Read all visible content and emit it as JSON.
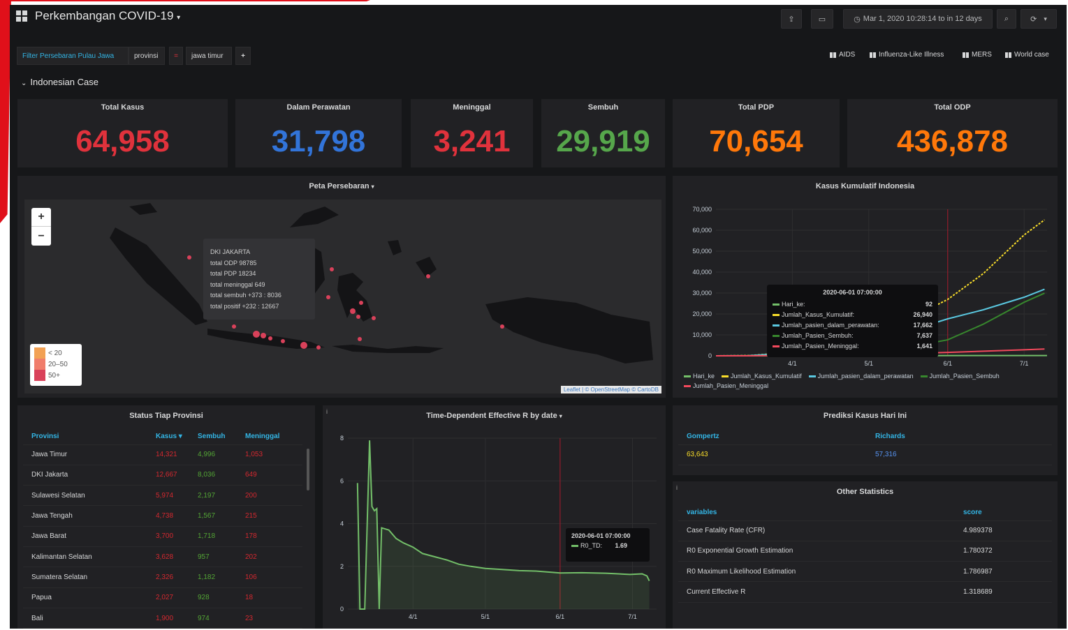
{
  "header": {
    "title": "Perkembangan COVID-19",
    "time_range": "Mar 1, 2020 10:28:14 to in 12 days"
  },
  "variables": {
    "filter_label": "Filter Persebaran Pulau Jawa",
    "var_name": "provinsi",
    "var_value": "jawa timur",
    "add_symbol": "+"
  },
  "links": [
    "AIDS",
    "Influenza-Like Illness",
    "MERS",
    "World case"
  ],
  "row_title": "Indonesian Case",
  "stats": [
    {
      "title": "Total Kasus",
      "value": "64,958",
      "color": "#e0323c"
    },
    {
      "title": "Dalam Perawatan",
      "value": "31,798",
      "color": "#3274d9"
    },
    {
      "title": "Meninggal",
      "value": "3,241",
      "color": "#e0323c"
    },
    {
      "title": "Sembuh",
      "value": "29,919",
      "color": "#56a64b"
    },
    {
      "title": "Total PDP",
      "value": "70,654",
      "color": "#ff780a"
    },
    {
      "title": "Total ODP",
      "value": "436,878",
      "color": "#ff780a"
    }
  ],
  "map_panel": {
    "title": "Peta Persebaran",
    "zoom_in": "+",
    "zoom_out": "−",
    "tooltip": [
      "DKI JAKARTA",
      "total ODP 98785",
      "total PDP 18234",
      "total meninggal 649",
      "total sembuh +373 : 8036",
      "total positif +232 : 12667"
    ],
    "legend": [
      {
        "label": "< 20",
        "color": "#f2a154"
      },
      {
        "label": "20–50",
        "color": "#f07d6b"
      },
      {
        "label": "50+",
        "color": "#d9415a"
      }
    ],
    "attribution": "Leaflet | © OpenStreetMap © CartoDB"
  },
  "cumulative_panel": {
    "title": "Kasus Kumulatif Indonesia",
    "tooltip_header": "2020-06-01 07:00:00",
    "tooltip_rows": [
      {
        "name": "Hari_ke:",
        "value": "92",
        "color": "#73bf69"
      },
      {
        "name": "Jumlah_Kasus_Kumulatif:",
        "value": "26,940",
        "color": "#fade2a"
      },
      {
        "name": "Jumlah_pasien_dalam_perawatan:",
        "value": "17,662",
        "color": "#5ac8e0"
      },
      {
        "name": "Jumlah_Pasien_Sembuh:",
        "value": "7,637",
        "color": "#37872d"
      },
      {
        "name": "Jumlah_Pasien_Meninggal:",
        "value": "1,641",
        "color": "#f2495c"
      }
    ],
    "legend": [
      {
        "name": "Hari_ke",
        "color": "#73bf69"
      },
      {
        "name": "Jumlah_Kasus_Kumulatif",
        "color": "#fade2a"
      },
      {
        "name": "Jumlah_pasien_dalam_perawatan",
        "color": "#5ac8e0"
      },
      {
        "name": "Jumlah_Pasien_Sembuh",
        "color": "#37872d"
      },
      {
        "name": "Jumlah_Pasien_Meninggal",
        "color": "#f2495c"
      }
    ]
  },
  "province_panel": {
    "title": "Status Tiap Provinsi",
    "columns": [
      "Provinsi",
      "Kasus ▾",
      "Sembuh",
      "Meninggal"
    ],
    "rows": [
      [
        "Jawa Timur",
        "14,321",
        "4,996",
        "1,053"
      ],
      [
        "DKI Jakarta",
        "12,667",
        "8,036",
        "649"
      ],
      [
        "Sulawesi Selatan",
        "5,974",
        "2,197",
        "200"
      ],
      [
        "Jawa Tengah",
        "4,738",
        "1,567",
        "215"
      ],
      [
        "Jawa Barat",
        "3,700",
        "1,718",
        "178"
      ],
      [
        "Kalimantan Selatan",
        "3,628",
        "957",
        "202"
      ],
      [
        "Sumatera Selatan",
        "2,326",
        "1,182",
        "106"
      ],
      [
        "Papua",
        "2,027",
        "928",
        "18"
      ],
      [
        "Bali",
        "1,900",
        "974",
        "23"
      ]
    ]
  },
  "rt_panel": {
    "title": "Time-Dependent Effective R by date",
    "tooltip_header": "2020-06-01 07:00:00",
    "tooltip_series": "R0_TD:",
    "tooltip_value": "1.69"
  },
  "prediction_panel": {
    "title": "Prediksi Kasus Hari Ini",
    "columns": [
      "Gompertz",
      "Richards"
    ],
    "values": [
      "63,643",
      "57,316"
    ]
  },
  "other_panel": {
    "title": "Other Statistics",
    "columns": [
      "variables",
      "score"
    ],
    "rows": [
      [
        "Case Fatality Rate (CFR)",
        "4.989378"
      ],
      [
        "R0 Exponential Growth Estimation",
        "1.780372"
      ],
      [
        "R0 Maximum Likelihood Estimation",
        "1.786987"
      ],
      [
        "Current Effective R",
        "1.318689"
      ]
    ]
  },
  "chart_data": [
    {
      "type": "line",
      "title": "Kasus Kumulatif Indonesia",
      "x_tick_labels": [
        "4/1",
        "5/1",
        "6/1",
        "7/1"
      ],
      "ylim": [
        0,
        70000
      ],
      "y_ticks": [
        "0",
        "10,000",
        "20,000",
        "30,000",
        "40,000",
        "50,000",
        "60,000",
        "70,000"
      ],
      "x_range": [
        "2020-03-02",
        "2020-07-10"
      ],
      "series": [
        {
          "name": "Hari_ke",
          "color": "#73bf69",
          "points": [
            [
              "2020-03-02",
              0
            ],
            [
              "2020-07-10",
              131
            ]
          ]
        },
        {
          "name": "Jumlah_Kasus_Kumulatif",
          "color": "#fade2a",
          "points": [
            [
              "2020-03-02",
              2
            ],
            [
              "2020-03-15",
              117
            ],
            [
              "2020-04-01",
              1677
            ],
            [
              "2020-04-15",
              5136
            ],
            [
              "2020-05-01",
              10551
            ],
            [
              "2020-05-15",
              16496
            ],
            [
              "2020-06-01",
              26940
            ],
            [
              "2020-06-15",
              39294
            ],
            [
              "2020-07-01",
              57770
            ],
            [
              "2020-07-09",
              64958
            ]
          ]
        },
        {
          "name": "Jumlah_pasien_dalam_perawatan",
          "color": "#5ac8e0",
          "points": [
            [
              "2020-03-02",
              2
            ],
            [
              "2020-03-15",
              105
            ],
            [
              "2020-04-01",
              1417
            ],
            [
              "2020-04-15",
              4134
            ],
            [
              "2020-05-01",
              7638
            ],
            [
              "2020-05-15",
              11220
            ],
            [
              "2020-06-01",
              17662
            ],
            [
              "2020-06-15",
              22000
            ],
            [
              "2020-07-01",
              28000
            ],
            [
              "2020-07-09",
              31798
            ]
          ]
        },
        {
          "name": "Jumlah_Pasien_Sembuh",
          "color": "#37872d",
          "points": [
            [
              "2020-03-02",
              0
            ],
            [
              "2020-03-15",
              8
            ],
            [
              "2020-04-01",
              103
            ],
            [
              "2020-04-15",
              446
            ],
            [
              "2020-05-01",
              1876
            ],
            [
              "2020-05-15",
              3803
            ],
            [
              "2020-06-01",
              7637
            ],
            [
              "2020-06-15",
              15123
            ],
            [
              "2020-07-01",
              25595
            ],
            [
              "2020-07-09",
              29919
            ]
          ]
        },
        {
          "name": "Jumlah_Pasien_Meninggal",
          "color": "#f2495c",
          "points": [
            [
              "2020-03-02",
              0
            ],
            [
              "2020-03-15",
              5
            ],
            [
              "2020-04-01",
              157
            ],
            [
              "2020-04-15",
              469
            ],
            [
              "2020-05-01",
              800
            ],
            [
              "2020-05-15",
              1076
            ],
            [
              "2020-06-01",
              1641
            ],
            [
              "2020-06-15",
              2198
            ],
            [
              "2020-07-01",
              2876
            ],
            [
              "2020-07-09",
              3241
            ]
          ]
        }
      ]
    },
    {
      "type": "area",
      "title": "Time-Dependent Effective R by date",
      "x_tick_labels": [
        "4/1",
        "5/1",
        "6/1",
        "7/1"
      ],
      "ylim": [
        0,
        8
      ],
      "y_ticks": [
        "0",
        "2",
        "4",
        "6",
        "8"
      ],
      "x_range": [
        "2020-03-05",
        "2020-07-11"
      ],
      "series": [
        {
          "name": "R0_TD",
          "color": "#73bf69",
          "points": [
            [
              "2020-03-09",
              5.9
            ],
            [
              "2020-03-10",
              0
            ],
            [
              "2020-03-12",
              0
            ],
            [
              "2020-03-14",
              7.9
            ],
            [
              "2020-03-15",
              4.8
            ],
            [
              "2020-03-16",
              4.6
            ],
            [
              "2020-03-17",
              4.7
            ],
            [
              "2020-03-18",
              0
            ],
            [
              "2020-03-19",
              3.8
            ],
            [
              "2020-03-22",
              3.7
            ],
            [
              "2020-03-25",
              3.3
            ],
            [
              "2020-03-28",
              3.1
            ],
            [
              "2020-04-01",
              2.9
            ],
            [
              "2020-04-05",
              2.6
            ],
            [
              "2020-04-10",
              2.45
            ],
            [
              "2020-04-15",
              2.3
            ],
            [
              "2020-04-20",
              2.1
            ],
            [
              "2020-04-25",
              2.0
            ],
            [
              "2020-05-01",
              1.9
            ],
            [
              "2020-05-08",
              1.85
            ],
            [
              "2020-05-15",
              1.8
            ],
            [
              "2020-05-22",
              1.78
            ],
            [
              "2020-06-01",
              1.69
            ],
            [
              "2020-06-10",
              1.7
            ],
            [
              "2020-06-20",
              1.68
            ],
            [
              "2020-06-30",
              1.62
            ],
            [
              "2020-07-05",
              1.65
            ],
            [
              "2020-07-07",
              1.55
            ],
            [
              "2020-07-08",
              1.32
            ]
          ]
        }
      ]
    }
  ]
}
